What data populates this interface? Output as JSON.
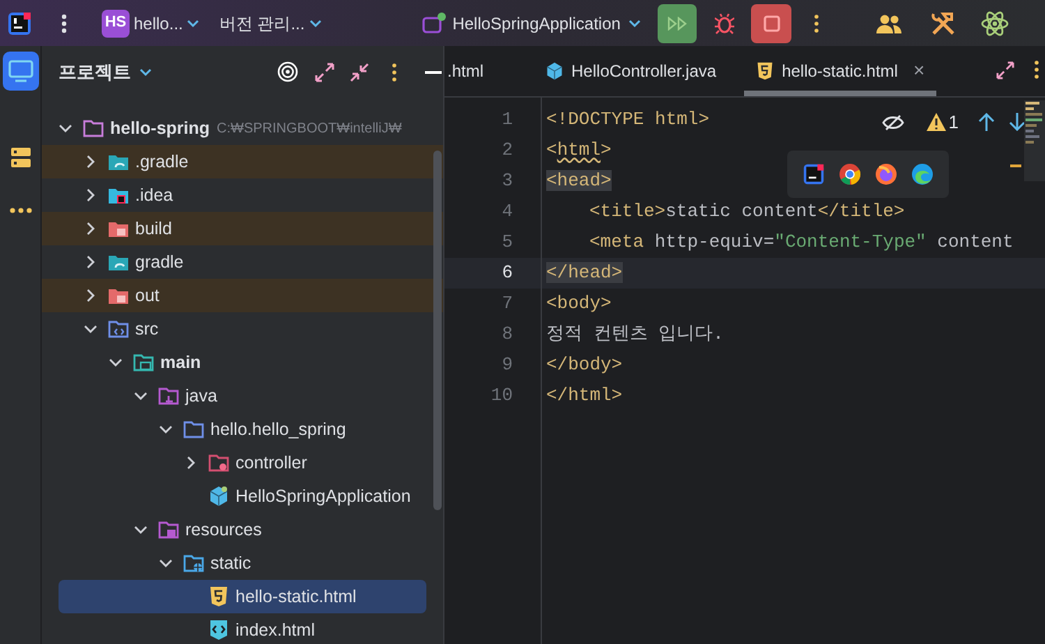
{
  "top_bar": {
    "project_badge": "HS",
    "project": "hello...",
    "vcs": "버전 관리...",
    "run_config": "HelloSpringApplication"
  },
  "side_strip": [
    {
      "kind": "project",
      "selected": true
    },
    {
      "kind": "structure",
      "selected": false
    },
    {
      "kind": "more",
      "selected": false
    }
  ],
  "project_panel": {
    "title": "프로젝트",
    "tree": [
      {
        "label": "hello-spring",
        "path": "C:₩SPRINGBOOT₩intelliJ₩",
        "kind": "module",
        "expanded": true,
        "excluded": false,
        "selected": false,
        "children": [
          {
            "label": ".gradle",
            "kind": "gradle-folder",
            "expanded": false,
            "excluded": true,
            "selected": false
          },
          {
            "label": ".idea",
            "kind": "idea-folder",
            "expanded": false,
            "excluded": false,
            "selected": false
          },
          {
            "label": "build",
            "kind": "excluded-folder",
            "expanded": false,
            "excluded": true,
            "selected": false
          },
          {
            "label": "gradle",
            "kind": "gradle-folder",
            "expanded": false,
            "excluded": false,
            "selected": false
          },
          {
            "label": "out",
            "kind": "excluded-folder",
            "expanded": false,
            "excluded": true,
            "selected": false
          },
          {
            "label": "src",
            "kind": "src-folder",
            "expanded": true,
            "excluded": false,
            "selected": false,
            "children": [
              {
                "label": "main",
                "kind": "source-set",
                "expanded": true,
                "excluded": false,
                "selected": false,
                "children": [
                  {
                    "label": "java",
                    "kind": "java-root",
                    "expanded": true,
                    "excluded": false,
                    "selected": false,
                    "children": [
                      {
                        "label": "hello.hello_spring",
                        "kind": "package",
                        "expanded": true,
                        "excluded": false,
                        "selected": false,
                        "children": [
                          {
                            "label": "controller",
                            "kind": "config-package",
                            "expanded": false,
                            "excluded": false,
                            "selected": false
                          },
                          {
                            "label": "HelloSpringApplication",
                            "kind": "spring-class",
                            "excluded": false,
                            "selected": false
                          }
                        ]
                      }
                    ]
                  },
                  {
                    "label": "resources",
                    "kind": "resources-root",
                    "expanded": true,
                    "excluded": false,
                    "selected": false,
                    "children": [
                      {
                        "label": "static",
                        "kind": "web-folder",
                        "expanded": true,
                        "excluded": false,
                        "selected": false,
                        "children": [
                          {
                            "label": "hello-static.html",
                            "kind": "html5-file",
                            "excluded": false,
                            "selected": true
                          },
                          {
                            "label": "index.html",
                            "kind": "html-file",
                            "excluded": false,
                            "selected": false
                          }
                        ]
                      }
                    ]
                  }
                ]
              }
            ]
          }
        ]
      }
    ]
  },
  "editor": {
    "tabs": [
      {
        "label": ".html",
        "kind": "cut",
        "selected": false
      },
      {
        "label": "HelloController.java",
        "kind": "java",
        "selected": false
      },
      {
        "label": "hello-static.html",
        "kind": "html5",
        "selected": true,
        "close": "×"
      }
    ],
    "warning_count": "1",
    "lines": [
      {
        "number": "1",
        "current": false,
        "indented": false,
        "segments": [
          {
            "kind": "tag",
            "text": "<!DOCTYPE html>"
          }
        ]
      },
      {
        "number": "2",
        "current": false,
        "indented": false,
        "segments": [
          {
            "kind": "tag",
            "text": "<"
          },
          {
            "kind": "tag-warning",
            "text": "html"
          },
          {
            "kind": "tag",
            "text": ">"
          }
        ]
      },
      {
        "number": "3",
        "current": false,
        "indented": false,
        "segments": [
          {
            "kind": "tag-match",
            "text": "<head>"
          }
        ]
      },
      {
        "number": "4",
        "current": false,
        "indented": true,
        "segments": [
          {
            "kind": "tag",
            "text": "<title>"
          },
          {
            "kind": "text",
            "text": "static content"
          },
          {
            "kind": "tag",
            "text": "</title>"
          }
        ]
      },
      {
        "number": "5",
        "current": false,
        "indented": true,
        "segments": [
          {
            "kind": "tag",
            "text": "<meta "
          },
          {
            "kind": "attr",
            "text": "http-equiv="
          },
          {
            "kind": "string",
            "text": "\"Content-Type\""
          },
          {
            "kind": "attr",
            "text": " content"
          }
        ]
      },
      {
        "number": "6",
        "current": true,
        "indented": false,
        "segments": [
          {
            "kind": "tag-match",
            "text": "</head>"
          }
        ]
      },
      {
        "number": "7",
        "current": false,
        "indented": false,
        "segments": [
          {
            "kind": "tag",
            "text": "<body>"
          }
        ]
      },
      {
        "number": "8",
        "current": false,
        "indented": false,
        "segments": [
          {
            "kind": "text",
            "text": "정적 컨텐츠 입니다."
          }
        ]
      },
      {
        "number": "9",
        "current": false,
        "indented": false,
        "segments": [
          {
            "kind": "tag",
            "text": "</body>"
          }
        ]
      },
      {
        "number": "10",
        "current": false,
        "indented": false,
        "segments": [
          {
            "kind": "tag",
            "text": "</html>"
          }
        ]
      }
    ]
  }
}
